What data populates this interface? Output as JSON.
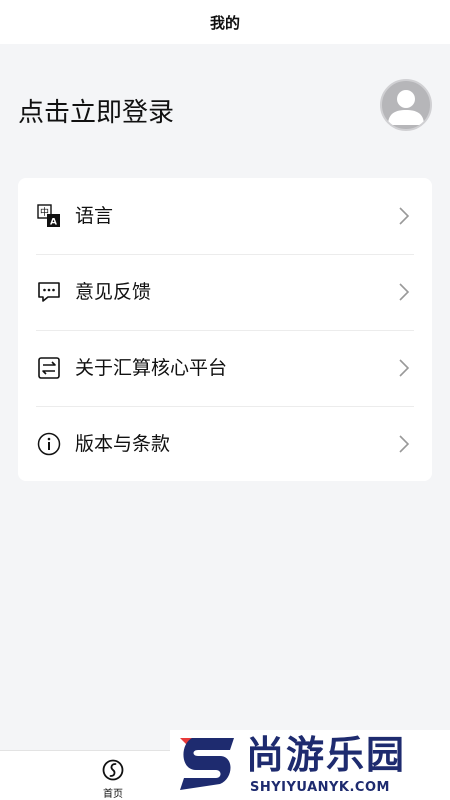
{
  "header": {
    "title": "我的"
  },
  "profile": {
    "login_prompt": "点击立即登录"
  },
  "menu": {
    "items": [
      {
        "label": "语言",
        "icon": "language-icon"
      },
      {
        "label": "意见反馈",
        "icon": "feedback-icon"
      },
      {
        "label": "关于汇算核心平台",
        "icon": "about-icon"
      },
      {
        "label": "版本与条款",
        "icon": "info-icon"
      }
    ]
  },
  "tabbar": {
    "home_label": "首页"
  },
  "watermark": {
    "brand_cn": "尚游乐园",
    "brand_en": "SHYIYUANYK.COM"
  },
  "colors": {
    "background": "#f4f5f7",
    "card": "#ffffff",
    "text": "#111111",
    "watermark": "#1e2b6f",
    "watermark_accent": "#e83a3a"
  }
}
